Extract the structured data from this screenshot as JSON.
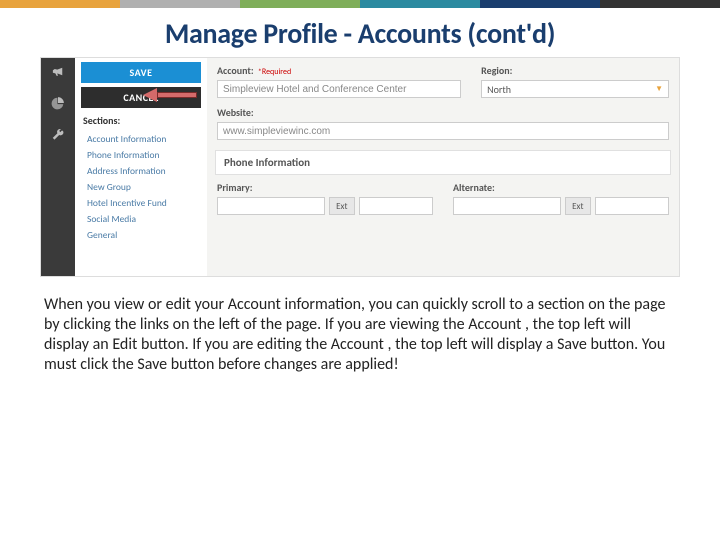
{
  "title": "Manage Profile - Accounts (cont'd)",
  "colors": {
    "topbar": [
      "#e8a33d",
      "#b0b0b0",
      "#7fae5a",
      "#2b8aa0",
      "#1a3e6e",
      "#333333"
    ],
    "save_btn": "#1b8fd4",
    "cancel_btn": "#2d2d2d",
    "link": "#4a7ba6",
    "required": "#cc0000"
  },
  "iconbar": {
    "icons": [
      "megaphone-icon",
      "pie-chart-icon",
      "wrench-icon"
    ]
  },
  "leftpane": {
    "save_label": "SAVE",
    "cancel_label": "CANCEL",
    "sections_label": "Sections:",
    "sections": [
      "Account Information",
      "Phone Information",
      "Address Information",
      "New Group",
      "Hotel Incentive Fund",
      "Social Media",
      "General"
    ]
  },
  "form": {
    "account": {
      "label": "Account:",
      "required_text": "*Required",
      "value": "Simpleview Hotel and Conference Center"
    },
    "region": {
      "label": "Region:",
      "value": "North"
    },
    "website": {
      "label": "Website:",
      "value": "www.simpleviewinc.com"
    },
    "phone_panel": "Phone Information",
    "primary": {
      "label": "Primary:",
      "ext_label": "Ext"
    },
    "alternate": {
      "label": "Alternate:",
      "ext_label": "Ext"
    }
  },
  "explain": "When you view or edit your Account information, you can quickly scroll to a section on the page by clicking the links on the left of the page.  If you are viewing the Account , the top left will display an Edit button.  If you are editing the Account , the top left will display a Save button.  You must click the Save button before changes are applied!"
}
